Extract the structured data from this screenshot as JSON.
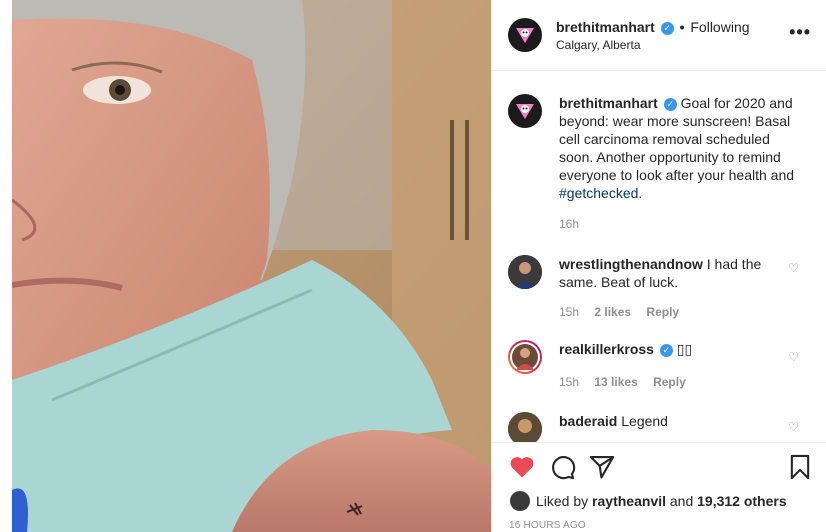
{
  "post": {
    "username": "brethitmanhart",
    "follow_status": "Following",
    "location": "Calgary, Alberta",
    "more_label": "•••"
  },
  "caption": {
    "username": "brethitmanhart",
    "text": "Goal for 2020 and beyond: wear more sunscreen! Basal cell carcinoma removal scheduled soon. Another opportunity to remind everyone to look after your health and",
    "hashtag": "#getchecked",
    "suffix": ".",
    "time": "16h"
  },
  "comments": [
    {
      "username": "wrestlingthenandnow",
      "text": "I had the same. Beat of luck.",
      "time": "15h",
      "likes": "2 likes",
      "reply": "Reply"
    },
    {
      "username": "realkillerkross",
      "text": "▯▯",
      "time": "15h",
      "likes": "13 likes",
      "reply": "Reply"
    },
    {
      "username": "baderaid",
      "text": "Legend",
      "time": "",
      "likes": "",
      "reply": ""
    }
  ],
  "likes": {
    "prefix": "Liked by",
    "user": "raytheanvil",
    "and_label": "and",
    "others": "19,312 others"
  },
  "timestamp": "16 HOURS AGO",
  "colors": {
    "verified": "#3897f0",
    "heart_liked": "#ed4956",
    "hashtag": "#00376b",
    "muted": "#8e8e8e"
  }
}
